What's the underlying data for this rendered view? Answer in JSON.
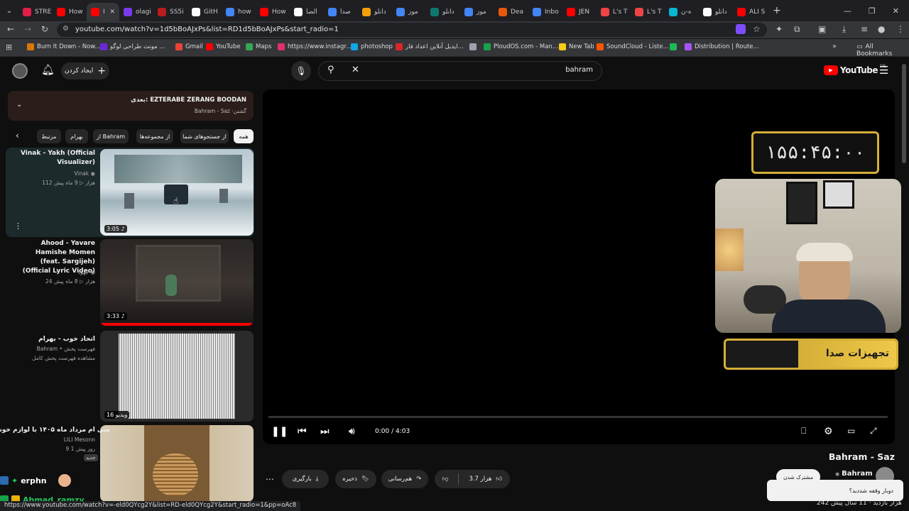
{
  "tabs": [
    {
      "label": "STRE",
      "color": "#e11d48"
    },
    {
      "label": "How",
      "color": "#ff0000"
    },
    {
      "label": "I",
      "color": "#ff0000"
    },
    {
      "label": "olagi",
      "color": "#7c3aed"
    },
    {
      "label": "SS5i",
      "color": "#b91c1c"
    },
    {
      "label": "GitH",
      "color": "#ffffff"
    },
    {
      "label": "how",
      "color": "#4285f4"
    },
    {
      "label": "How",
      "color": "#ff0000"
    },
    {
      "label": "الصا",
      "color": "#ffffff"
    },
    {
      "label": "صدا",
      "color": "#4285f4"
    },
    {
      "label": "دانلو",
      "color": "#f59e0b"
    },
    {
      "label": "موز",
      "color": "#4285f4"
    },
    {
      "label": "دانلو",
      "color": "#0f766e"
    },
    {
      "label": "موز",
      "color": "#4285f4"
    },
    {
      "label": "Dea",
      "color": "#ea580c"
    },
    {
      "label": "Inbo",
      "color": "#4285f4"
    },
    {
      "label": "JEN",
      "color": "#ff0000"
    },
    {
      "label": "L's T",
      "color": "#ef4444"
    },
    {
      "label": "L's T",
      "color": "#ef4444"
    },
    {
      "label": "ه-ن",
      "color": "#06b6d4"
    },
    {
      "label": "دانلو",
      "color": "#ffffff"
    },
    {
      "label": "ALI S",
      "color": "#ff0000"
    }
  ],
  "address": {
    "url": "youtube.com/watch?v=1d5bBoAJxPs&list=RD1d5bBoAJxPs&start_radio=1"
  },
  "bookmarks": [
    {
      "label": "Burn It Down - Now...",
      "color": "#d97706"
    },
    {
      "label": "مونت طراحی لوگو ...",
      "color": "#6d28d9"
    },
    {
      "label": "Gmail",
      "color": "#ea4335"
    },
    {
      "label": "YouTube",
      "color": "#ff0000"
    },
    {
      "label": "Maps",
      "color": "#34a853"
    },
    {
      "label": "https://www.instagr...",
      "color": "#e1306c"
    },
    {
      "label": "photoshop",
      "color": "#0ea5e9"
    },
    {
      "label": "ایدیل آنلاین اعداد فار...",
      "color": "#dc2626"
    },
    {
      "label": "",
      "color": "#9ca3af"
    },
    {
      "label": "PloudOS.com - Man...",
      "color": "#16a34a"
    },
    {
      "label": "New Tab",
      "color": "#facc15"
    },
    {
      "label": "SoundCloud - Liste...",
      "color": "#ff5500"
    },
    {
      "label": "",
      "color": "#1db954"
    },
    {
      "label": "Distribution | Route...",
      "color": "#a855f7"
    }
  ],
  "all_bookmarks": "All Bookmarks",
  "yt": {
    "create_label": "ایجاد کردن",
    "search_value": "bahram",
    "logo_text": "YouTube",
    "logo_region": "DE"
  },
  "playlist": {
    "title": "بعدی: EZTERABE ZERANG BOODAN",
    "subtitle": "Bahram - Saz ·گشتن"
  },
  "chips": [
    "همه",
    "از جستجوهای شما",
    "از مجموعه‌ها",
    "از Bahram",
    "بهرام",
    "مرتبط"
  ],
  "videos": [
    {
      "title": "Vinak - Yakh (Official Visualizer)",
      "channel": "Vinak",
      "meta": "112 هزار ▷ 9 ماه پیش",
      "duration": "3:05 ♪"
    },
    {
      "title": "Ahood - Yavare Hamishe Momen (feat. Sargijeh) (Official Lyric Video)",
      "channel": "جهود",
      "meta": "24 هزار ▷ 8 ماه پیش",
      "duration": "3:33 ♪"
    },
    {
      "title": "اتحاد خوب - بهرام",
      "channel": "Bahram • فهرست پخش",
      "meta": "مشاهده فهرست پخش کامل",
      "duration": "16 ویدیو"
    },
    {
      "title": "سی ام مرداد ماه ۱۴۰۵ با لوازم خونه",
      "channel": "LILI Mesonn",
      "meta": "9 1 روز پیش",
      "badge": "جدید"
    }
  ],
  "chat": [
    {
      "user": "erphn"
    },
    {
      "user": "Ahmad_ramzy"
    }
  ],
  "overlay": {
    "timer": "۱۵۵:۴۵:۰۰",
    "banner": "تجهیزات صدا"
  },
  "player": {
    "time": "0:00 / 4:03",
    "progress": 0
  },
  "video_title": "Bahram - Saz",
  "channel_name": "Bahram",
  "subscribe_label": "مشترک شدن",
  "actions": {
    "like_count": "3.7 هزار",
    "share": "هم‌رسانی",
    "save": "ذخیره",
    "download": "بارگیری"
  },
  "toast": "دوبار وقفه شد‌دید؟",
  "status_url": "https://www.youtube.com/watch?v=-eld0QYcg2Y&list=RD-eld0QYcg2Y&start_radio=1&pp=oAc8",
  "views_line": "242 هزار بازدید · 11 سال پیش"
}
